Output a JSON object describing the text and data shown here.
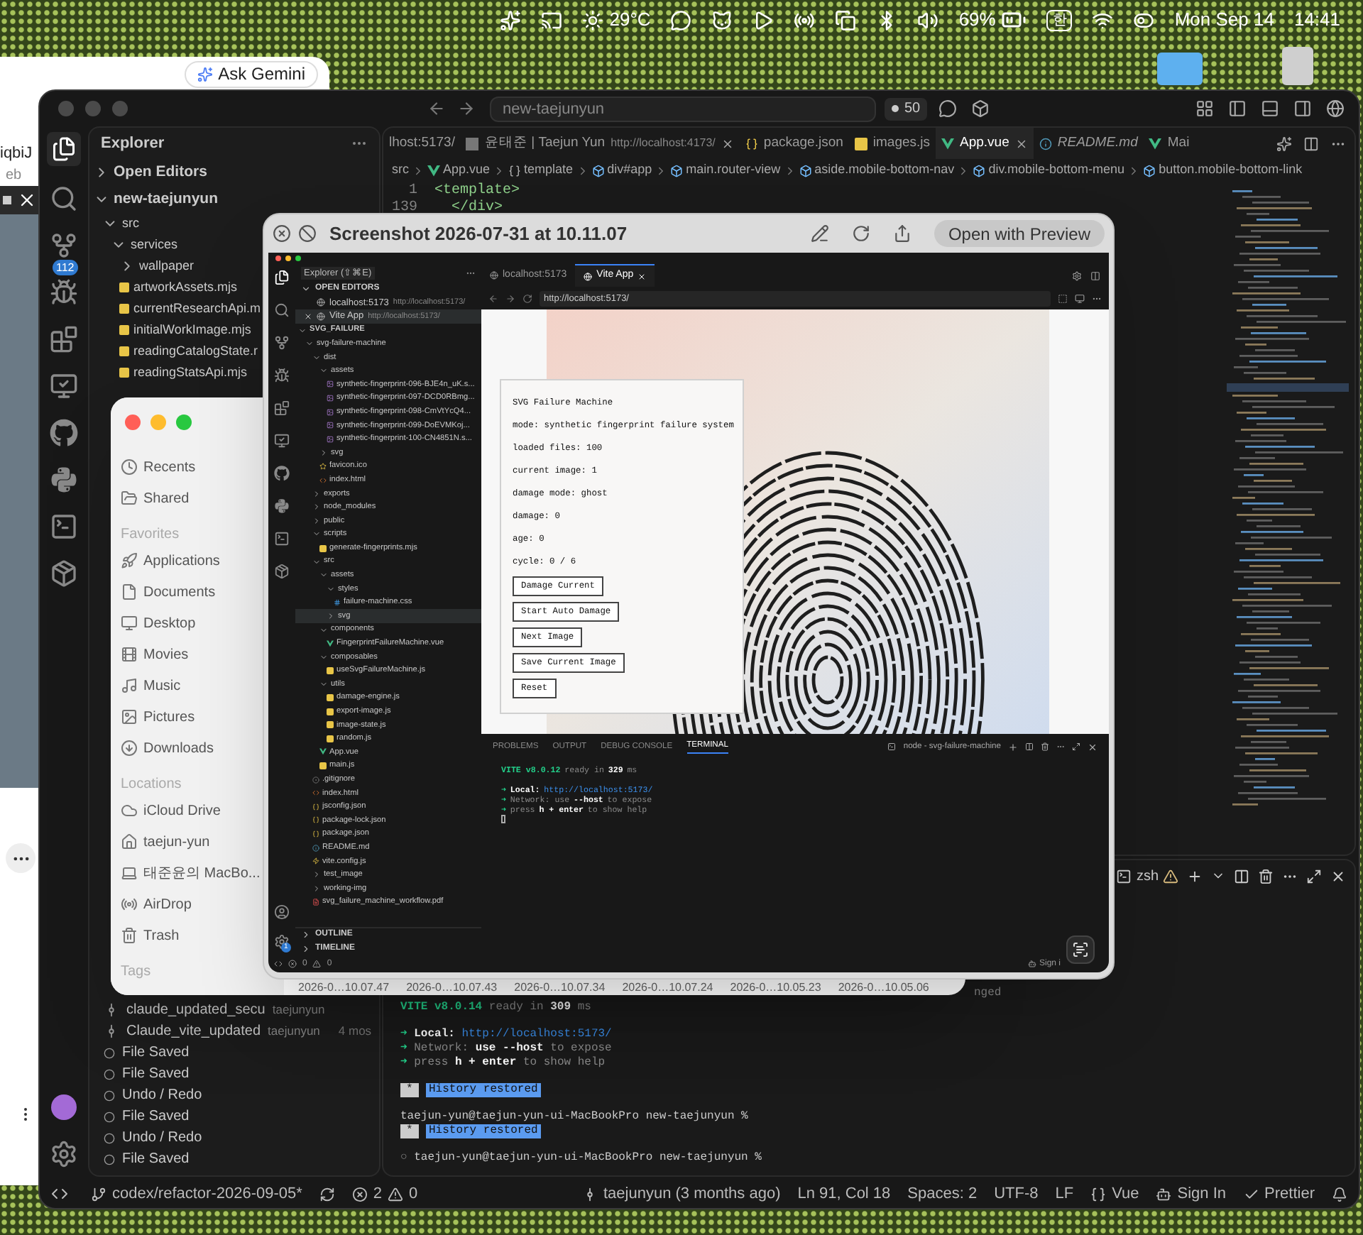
{
  "menu_bar": {
    "weather": "29°C",
    "battery": "69%",
    "input_source": "한",
    "date": "Mon Sep 14",
    "time": "14:41"
  },
  "browser": {
    "ask_button": "Ask Gemini",
    "url_fragment": "iqbiJ",
    "label_fragment": "eb"
  },
  "vscode": {
    "search": "new-taejunyun",
    "agent_count": "50",
    "source_control_badge": "112",
    "explorer": {
      "title": "Explorer",
      "tree": [
        {
          "label": "Open Editors",
          "kind": "section",
          "expanded": false
        },
        {
          "label": "new-taejunyun",
          "kind": "section",
          "expanded": true,
          "children": [
            {
              "label": "src",
              "kind": "folder",
              "expanded": true,
              "children": [
                {
                  "label": "services",
                  "kind": "folder",
                  "expanded": true,
                  "children": [
                    {
                      "label": "wallpaper",
                      "kind": "folder",
                      "expanded": false
                    },
                    {
                      "label": "artworkAssets.mjs",
                      "kind": "js"
                    },
                    {
                      "label": "currentResearchApi.m",
                      "kind": "js"
                    },
                    {
                      "label": "initialWorkImage.mjs",
                      "kind": "js"
                    },
                    {
                      "label": "readingCatalogState.r",
                      "kind": "js"
                    },
                    {
                      "label": "readingStatsApi.mjs",
                      "kind": "js"
                    }
                  ]
                }
              ]
            }
          ]
        }
      ]
    },
    "timeline": [
      {
        "label": "claude_updated_secu",
        "author": "taejunyun",
        "kind": "commit"
      },
      {
        "label": "Claude_vite_updated",
        "author": "taejunyun",
        "age": "4 mos",
        "kind": "commit"
      },
      {
        "label": "File Saved",
        "kind": "local"
      },
      {
        "label": "File Saved",
        "kind": "local"
      },
      {
        "label": "Undo / Redo",
        "kind": "local"
      },
      {
        "label": "File Saved",
        "kind": "local"
      },
      {
        "label": "Undo / Redo",
        "kind": "local"
      },
      {
        "label": "File Saved",
        "kind": "local"
      }
    ],
    "tabs": [
      {
        "label": "lhost:5173/",
        "kind": "cut",
        "selected": false,
        "closable": false,
        "preview": false
      },
      {
        "label": "윤태준 | Taejun Yun",
        "detail": "http://localhost:4173/",
        "kind": "image",
        "selected": false,
        "closable": true,
        "preview": false
      },
      {
        "label": "package.json",
        "kind": "json",
        "selected": false,
        "closable": false,
        "preview": false
      },
      {
        "label": "images.js",
        "kind": "js",
        "selected": false,
        "closable": false,
        "preview": false
      },
      {
        "label": "App.vue",
        "kind": "vue",
        "selected": true,
        "closable": true,
        "preview": false
      },
      {
        "label": "README.md",
        "kind": "md",
        "selected": false,
        "closable": false,
        "preview": true
      },
      {
        "label": "Mai",
        "kind": "vue",
        "selected": false,
        "closable": false,
        "preview": false
      }
    ],
    "breadcrumbs": [
      {
        "label": "src",
        "kind": "folder"
      },
      {
        "label": "App.vue",
        "kind": "vue"
      },
      {
        "label": "template",
        "kind": "braces"
      },
      {
        "label": "div#app",
        "kind": "element"
      },
      {
        "label": "main.router-view",
        "kind": "element"
      },
      {
        "label": "aside.mobile-bottom-nav",
        "kind": "element"
      },
      {
        "label": "div.mobile-bottom-menu",
        "kind": "element"
      },
      {
        "label": "button.mobile-bottom-link",
        "kind": "element"
      }
    ],
    "code_lines": [
      {
        "number": "1",
        "code": "<template>"
      },
      {
        "number": "139",
        "code": "  </div>"
      }
    ],
    "terminal": {
      "shell": "zsh",
      "lines": [
        {
          "kind": "fragment",
          "segments": [
            {
              "text": "nged",
              "kind": "dim"
            }
          ]
        },
        {
          "kind": "line",
          "segments": [
            {
              "text": "VITE v8.0.14",
              "kind": "green"
            },
            {
              "text": "ready in",
              "kind": "dim"
            },
            {
              "text": "309",
              "kind": "bold"
            },
            {
              "text": "ms",
              "kind": "dim"
            }
          ]
        },
        {
          "kind": "blank"
        },
        {
          "kind": "line",
          "segments": [
            {
              "text": "➜",
              "kind": "arrow"
            },
            {
              "text": "Local:",
              "kind": "bold"
            },
            {
              "text": "http://localhost:5173/",
              "kind": "link"
            }
          ]
        },
        {
          "kind": "line",
          "segments": [
            {
              "text": "➜",
              "kind": "arrow"
            },
            {
              "text": "Network:",
              "kind": "dim"
            },
            {
              "text": "use --host",
              "kind": "bold"
            },
            {
              "text": "to expose",
              "kind": "dim"
            }
          ]
        },
        {
          "kind": "line",
          "segments": [
            {
              "text": "➜",
              "kind": "arrow"
            },
            {
              "text": "press",
              "kind": "dim"
            },
            {
              "text": "h + enter",
              "kind": "bold"
            },
            {
              "text": "to show help",
              "kind": "dim"
            }
          ]
        },
        {
          "kind": "blank"
        },
        {
          "kind": "line",
          "segments": [
            {
              "text": "*",
              "kind": "badge"
            },
            {
              "text": "History restored",
              "kind": "highlight"
            }
          ]
        },
        {
          "kind": "blank"
        },
        {
          "kind": "line",
          "segments": [
            {
              "text": "taejun-yun@taejun-yun-ui-MacBookPro new-taejunyun %",
              "kind": "plain"
            }
          ]
        },
        {
          "kind": "line",
          "segments": [
            {
              "text": "*",
              "kind": "badge"
            },
            {
              "text": "History restored",
              "kind": "highlight"
            }
          ]
        },
        {
          "kind": "blank"
        },
        {
          "kind": "line",
          "segments": [
            {
              "text": "○",
              "kind": "dim"
            },
            {
              "text": "taejun-yun@taejun-yun-ui-MacBookPro new-taejunyun %",
              "kind": "plain"
            }
          ]
        }
      ]
    },
    "status_bar": {
      "branch": "codex/refactor-2026-09-05*",
      "errors": "2",
      "warnings": "0",
      "blame": "taejunyun (3 months ago)",
      "position": "Ln 91, Col 18",
      "spaces": "Spaces: 2",
      "encoding": "UTF-8",
      "eol": "LF",
      "language": "Vue",
      "sign_in": "Sign In",
      "formatter": "Prettier"
    }
  },
  "finder": {
    "groups": [
      {
        "items": [
          {
            "label": "Recents",
            "kind": "recents"
          },
          {
            "label": "Shared",
            "kind": "shared"
          }
        ]
      },
      {
        "header": "Favorites",
        "items": [
          {
            "label": "Applications",
            "kind": "applications"
          },
          {
            "label": "Documents",
            "kind": "documents"
          },
          {
            "label": "Desktop",
            "kind": "desktop"
          },
          {
            "label": "Movies",
            "kind": "movies"
          },
          {
            "label": "Music",
            "kind": "music"
          },
          {
            "label": "Pictures",
            "kind": "pictures"
          },
          {
            "label": "Downloads",
            "kind": "downloads"
          }
        ]
      },
      {
        "header": "Locations",
        "items": [
          {
            "label": "iCloud Drive",
            "kind": "icloud"
          },
          {
            "label": "taejun-yun",
            "kind": "home"
          },
          {
            "label": "태준윤의 MacBo...",
            "kind": "computer"
          },
          {
            "label": "AirDrop",
            "kind": "airdrop"
          },
          {
            "label": "Trash",
            "kind": "trash"
          }
        ]
      },
      {
        "header": "Tags"
      }
    ],
    "file_dates": [
      "2026-0…10.07.47",
      "2026-0…10.07.43",
      "2026-0…10.07.34",
      "2026-0…10.07.24",
      "2026-0…10.05.23",
      "2026-0…10.05.06"
    ]
  },
  "quick_look": {
    "title": "Screenshot 2026-07-31 at 10.11.07",
    "open_button": "Open with Preview",
    "screenshot": {
      "settings_badge": "1",
      "explorer": {
        "title": "Explorer (⇧⌘E)",
        "open_editors": {
          "label": "OPEN EDITORS",
          "expanded": true,
          "items": [
            {
              "label": "localhost:5173",
              "detail": "http://localhost:5173/",
              "selected": false
            },
            {
              "label": "Vite App",
              "detail": "http://localhost:5173/",
              "selected": true
            }
          ]
        },
        "tree": [
          {
            "label": "SVG_FAILURE",
            "kind": "section",
            "expanded": true,
            "selected": false,
            "children": [
              {
                "label": "svg-failure-machine",
                "kind": "folder",
                "expanded": true,
                "selected": false,
                "children": [
                  {
                    "label": "dist",
                    "kind": "folder",
                    "expanded": true,
                    "selected": false,
                    "children": [
                      {
                        "label": "assets",
                        "kind": "folder",
                        "expanded": true,
                        "selected": false,
                        "children": [
                          {
                            "label": "synthetic-fingerprint-096-BJE4n_uK.s...",
                            "kind": "svgimg",
                            "selected": false
                          },
                          {
                            "label": "synthetic-fingerprint-097-DCD0RBmg...",
                            "kind": "svgimg",
                            "selected": false
                          },
                          {
                            "label": "synthetic-fingerprint-098-CmVtYcQ4...",
                            "kind": "svgimg",
                            "selected": false
                          },
                          {
                            "label": "synthetic-fingerprint-099-DoEVMKoj...",
                            "kind": "svgimg",
                            "selected": false
                          },
                          {
                            "label": "synthetic-fingerprint-100-CN4851N.s...",
                            "kind": "svgimg",
                            "selected": false
                          }
                        ]
                      },
                      {
                        "label": "svg",
                        "kind": "folder",
                        "expanded": false,
                        "selected": false
                      },
                      {
                        "label": "favicon.ico",
                        "kind": "ico",
                        "selected": false
                      },
                      {
                        "label": "index.html",
                        "kind": "html",
                        "selected": false
                      }
                    ]
                  },
                  {
                    "label": "exports",
                    "kind": "folder",
                    "expanded": false,
                    "selected": false
                  },
                  {
                    "label": "node_modules",
                    "kind": "folder",
                    "expanded": false,
                    "selected": false
                  },
                  {
                    "label": "public",
                    "kind": "folder",
                    "expanded": false,
                    "selected": false
                  },
                  {
                    "label": "scripts",
                    "kind": "folder",
                    "expanded": true,
                    "selected": false,
                    "children": [
                      {
                        "label": "generate-fingerprints.mjs",
                        "kind": "js",
                        "selected": false
                      }
                    ]
                  },
                  {
                    "label": "src",
                    "kind": "folder",
                    "expanded": true,
                    "selected": false,
                    "children": [
                      {
                        "label": "assets",
                        "kind": "folder",
                        "expanded": true,
                        "selected": false,
                        "children": [
                          {
                            "label": "styles",
                            "kind": "folder",
                            "expanded": true,
                            "selected": false,
                            "children": [
                              {
                                "label": "failure-machine.css",
                                "kind": "css",
                                "selected": false
                              }
                            ]
                          },
                          {
                            "label": "svg",
                            "kind": "folder",
                            "expanded": false,
                            "selected": true
                          }
                        ]
                      },
                      {
                        "label": "components",
                        "kind": "folder",
                        "expanded": true,
                        "selected": false,
                        "children": [
                          {
                            "label": "FingerprintFailureMachine.vue",
                            "kind": "vue",
                            "selected": false
                          }
                        ]
                      },
                      {
                        "label": "composables",
                        "kind": "folder",
                        "expanded": true,
                        "selected": false,
                        "children": [
                          {
                            "label": "useSvgFailureMachine.js",
                            "kind": "js",
                            "selected": false
                          }
                        ]
                      },
                      {
                        "label": "utils",
                        "kind": "folder",
                        "expanded": true,
                        "selected": false,
                        "children": [
                          {
                            "label": "damage-engine.js",
                            "kind": "js",
                            "selected": false
                          },
                          {
                            "label": "export-image.js",
                            "kind": "js",
                            "selected": false
                          },
                          {
                            "label": "image-state.js",
                            "kind": "js",
                            "selected": false
                          },
                          {
                            "label": "random.js",
                            "kind": "js",
                            "selected": false
                          }
                        ]
                      },
                      {
                        "label": "App.vue",
                        "kind": "vue",
                        "selected": false
                      },
                      {
                        "label": "main.js",
                        "kind": "js",
                        "selected": false
                      }
                    ]
                  },
                  {
                    "label": ".gitignore",
                    "kind": "git",
                    "selected": false
                  },
                  {
                    "label": "index.html",
                    "kind": "html",
                    "selected": false
                  },
                  {
                    "label": "jsconfig.json",
                    "kind": "json",
                    "selected": false
                  },
                  {
                    "label": "package-lock.json",
                    "kind": "json",
                    "selected": false
                  },
                  {
                    "label": "package.json",
                    "kind": "json",
                    "selected": false
                  },
                  {
                    "label": "README.md",
                    "kind": "md",
                    "selected": false
                  },
                  {
                    "label": "vite.config.js",
                    "kind": "config",
                    "selected": false
                  },
                  {
                    "label": "test_image",
                    "kind": "folder",
                    "expanded": false,
                    "selected": false
                  },
                  {
                    "label": "working-img",
                    "kind": "folder",
                    "expanded": false,
                    "selected": false
                  },
                  {
                    "label": "svg_failure_machine_workflow.pdf",
                    "kind": "pdf",
                    "selected": false
                  }
                ]
              }
            ]
          }
        ],
        "bottom_sections": [
          {
            "label": "OUTLINE",
            "expanded": false
          },
          {
            "label": "TIMELINE",
            "expanded": false
          }
        ]
      },
      "tabs": [
        {
          "label": "localhost:5173",
          "selected": false
        },
        {
          "label": "Vite App",
          "selected": true
        }
      ],
      "url": "http://localhost:5173/",
      "page": {
        "lines": [
          "SVG Failure Machine",
          "mode: synthetic fingerprint failure system",
          "loaded files: 100",
          "current image: 1",
          "damage mode: ghost",
          "damage: 0",
          "age: 0",
          "cycle: 0 / 6"
        ],
        "buttons": [
          "Damage Current",
          "Start Auto Damage",
          "Next Image",
          "Save Current Image",
          "Reset"
        ]
      },
      "panel_tabs": [
        {
          "label": "PROBLEMS",
          "selected": false
        },
        {
          "label": "OUTPUT",
          "selected": false
        },
        {
          "label": "DEBUG CONSOLE",
          "selected": false
        },
        {
          "label": "TERMINAL",
          "selected": true
        }
      ],
      "terminal_title": "node - svg-failure-machine",
      "terminal_lines": [
        {
          "kind": "line",
          "segments": [
            {
              "text": "VITE v8.0.12",
              "kind": "green"
            },
            {
              "text": "ready in",
              "kind": "dim"
            },
            {
              "text": "329",
              "kind": "bold"
            },
            {
              "text": "ms",
              "kind": "dim"
            }
          ]
        },
        {
          "kind": "blank"
        },
        {
          "kind": "line",
          "segments": [
            {
              "text": "➜",
              "kind": "arrow"
            },
            {
              "text": "Local:",
              "kind": "bold"
            },
            {
              "text": "http://localhost:5173/",
              "kind": "link"
            }
          ]
        },
        {
          "kind": "line",
          "segments": [
            {
              "text": "➜",
              "kind": "arrow"
            },
            {
              "text": "Network: use",
              "kind": "dim"
            },
            {
              "text": "--host",
              "kind": "bold"
            },
            {
              "text": "to expose",
              "kind": "dim"
            }
          ]
        },
        {
          "kind": "line",
          "segments": [
            {
              "text": "➜",
              "kind": "arrow"
            },
            {
              "text": "press",
              "kind": "dim"
            },
            {
              "text": "h + enter",
              "kind": "bold"
            },
            {
              "text": "to show help",
              "kind": "dim"
            }
          ]
        },
        {
          "kind": "cursor"
        }
      ],
      "status_bar": {
        "errors": "0",
        "warnings": "0",
        "sign_in": "Sign i"
      }
    }
  }
}
